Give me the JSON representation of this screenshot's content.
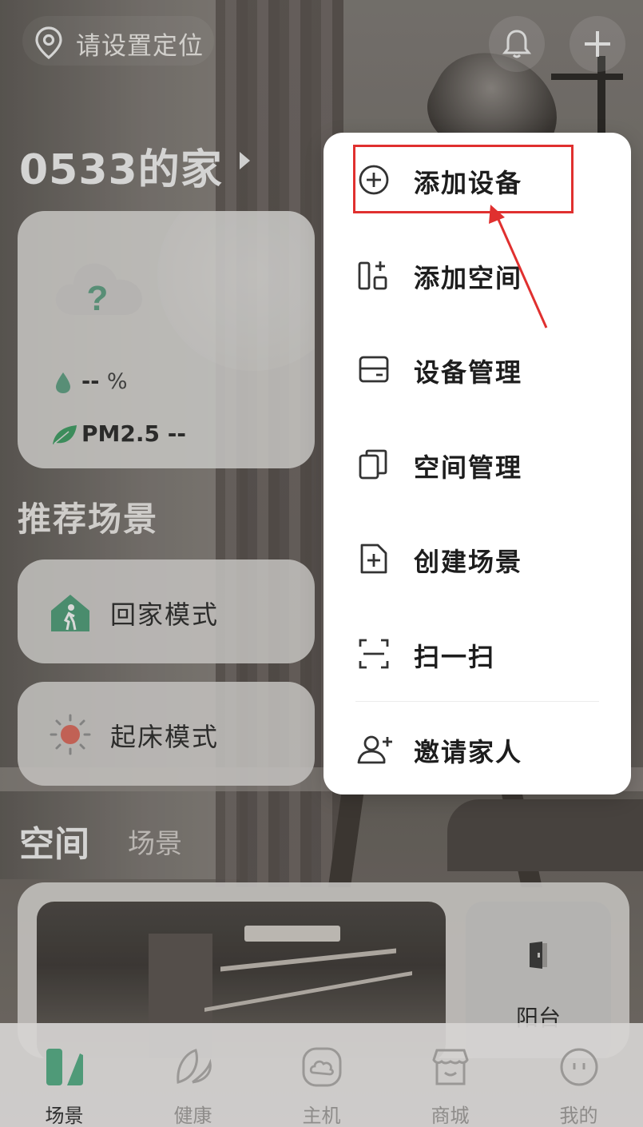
{
  "topbar": {
    "location_text": "请设置定位"
  },
  "home": {
    "title": "0533的家"
  },
  "weather": {
    "humidity_value": "--",
    "humidity_unit": "%",
    "pm_label": "PM2.5 --"
  },
  "recommended": {
    "title": "推荐场景",
    "scenes": [
      {
        "label": "回家模式",
        "icon": "home-walk-icon"
      },
      {
        "label": "起床模式",
        "icon": "sunrise-icon"
      }
    ]
  },
  "tabs": {
    "space": "空间",
    "scene": "场景"
  },
  "rooms": [
    {
      "label": "阳台",
      "icon": "door-icon"
    }
  ],
  "menu": {
    "items": [
      {
        "label": "添加设备",
        "icon": "plus-circle-icon"
      },
      {
        "label": "添加空间",
        "icon": "add-space-icon"
      },
      {
        "label": "设备管理",
        "icon": "device-manage-icon"
      },
      {
        "label": "空间管理",
        "icon": "space-manage-icon"
      },
      {
        "label": "创建场景",
        "icon": "create-scene-icon"
      },
      {
        "label": "扫一扫",
        "icon": "scan-icon"
      },
      {
        "label": "邀请家人",
        "icon": "invite-user-icon"
      }
    ]
  },
  "bottom_nav": {
    "items": [
      {
        "label": "场景",
        "icon": "scene-icon",
        "active": true
      },
      {
        "label": "健康",
        "icon": "leaf-icon",
        "active": false
      },
      {
        "label": "主机",
        "icon": "hub-icon",
        "active": false
      },
      {
        "label": "商城",
        "icon": "store-icon",
        "active": false
      },
      {
        "label": "我的",
        "icon": "profile-icon",
        "active": false
      }
    ]
  },
  "colors": {
    "accent_green": "#4f9a78",
    "highlight_red": "#e0302f"
  }
}
